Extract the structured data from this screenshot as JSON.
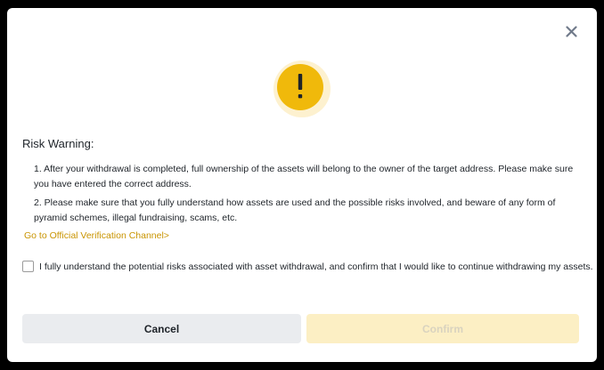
{
  "dialog": {
    "close_icon": "close-icon",
    "warning_icon": "exclamation-icon",
    "title": "Risk Warning:",
    "items": [
      "1. After your withdrawal is completed, full ownership of the assets will belong to the owner of the target address. Please make sure you have entered the correct address.",
      "2. Please make sure that you fully understand how assets are used and the possible risks involved, and beware of any form of pyramid schemes, illegal fundraising, scams, etc."
    ],
    "link_text": "Go to Official Verification Channel>",
    "checkbox": {
      "label": "I fully understand the potential risks associated with asset withdrawal, and confirm that I would like to continue withdrawing my assets.",
      "checked": false
    },
    "buttons": {
      "cancel": "Cancel",
      "confirm": "Confirm"
    }
  },
  "colors": {
    "accent": "#f0b90b",
    "link": "#c99400",
    "confirm_disabled_bg": "#fcefc4",
    "cancel_bg": "#eaecef",
    "text": "#1e2329"
  }
}
